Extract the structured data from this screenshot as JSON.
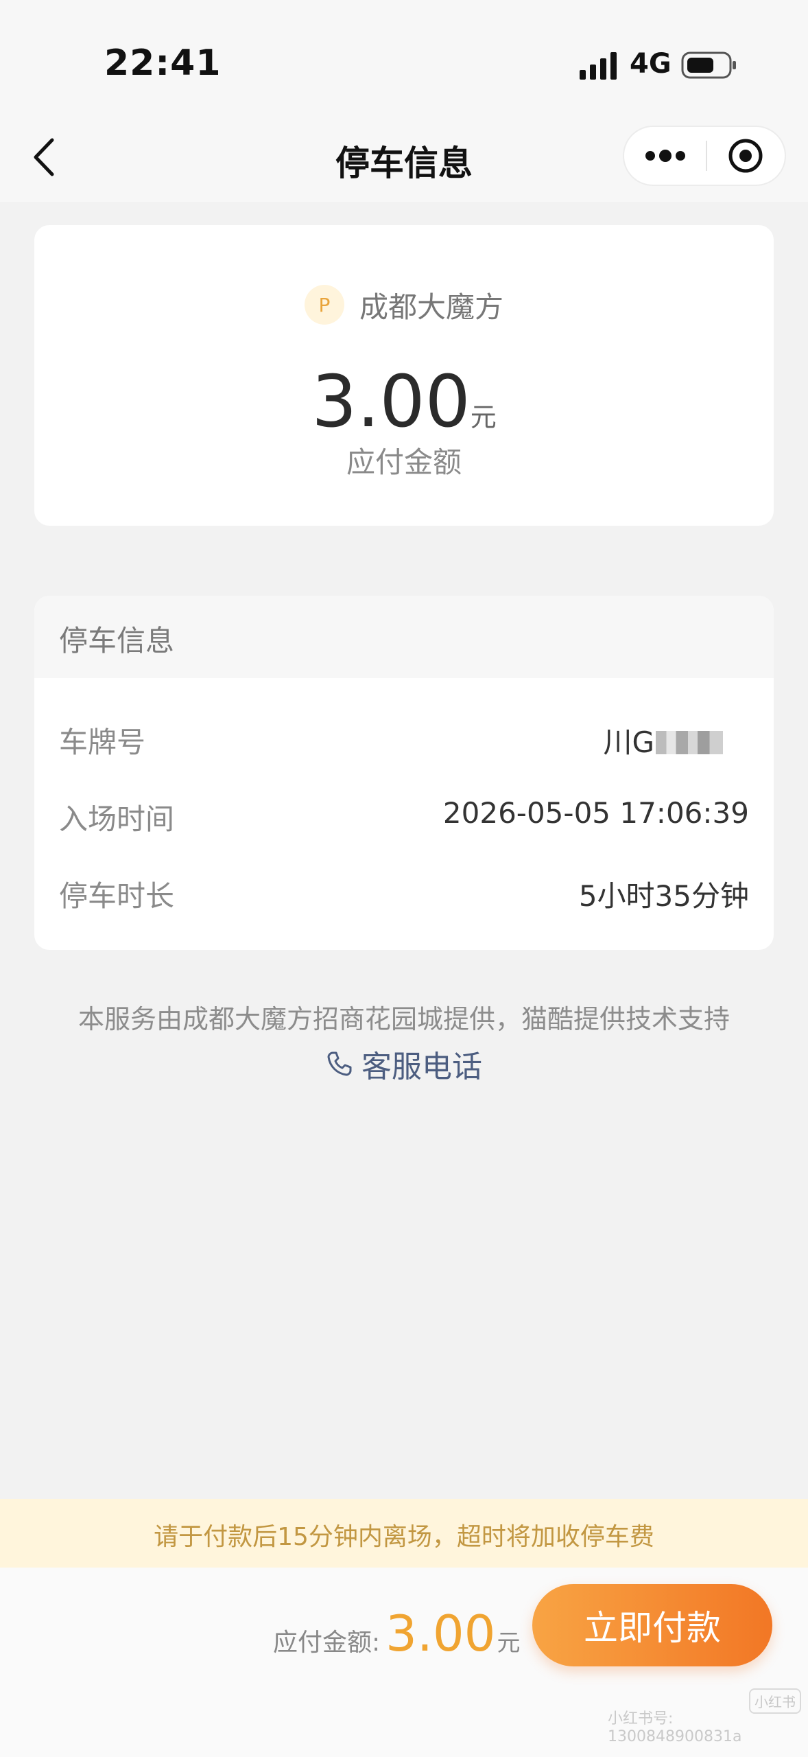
{
  "status_bar": {
    "time": "22:41",
    "network": "4G",
    "icons": [
      "signal-icon",
      "battery-icon"
    ]
  },
  "nav": {
    "title": "停车信息",
    "icons": [
      "chevron-left-icon",
      "more-dots-icon",
      "target-close-icon"
    ]
  },
  "amount_card": {
    "badge": "P",
    "lot_name": "成都大魔方",
    "amount": "3.00",
    "unit": "元",
    "label": "应付金额"
  },
  "info_card": {
    "title": "停车信息",
    "rows": [
      {
        "label": "车牌号",
        "value": "川G"
      },
      {
        "label": "入场时间",
        "value": "2026-05-05 17:06:39"
      },
      {
        "label": "停车时长",
        "value": "5小时35分钟"
      }
    ]
  },
  "provider_note": "本服务由成都大魔方招商花园城提供，猫酷提供技术支持",
  "service_phone": {
    "label": "客服电话",
    "icon": "phone-icon"
  },
  "notice": "请于付款后15分钟内离场，超时将加收停车费",
  "bottom_bar": {
    "label": "应付金额:",
    "amount": "3.00",
    "unit": "元",
    "button": "立即付款"
  },
  "watermark": {
    "text": "小红书号: 1300848900831a",
    "logo": "小红书"
  },
  "colors": {
    "accent": "#f0a431",
    "button_start": "#f8a444",
    "button_end": "#f27725",
    "notice_bg": "#fff5dc",
    "notice_text": "#c29742",
    "link": "#4c5d80"
  }
}
